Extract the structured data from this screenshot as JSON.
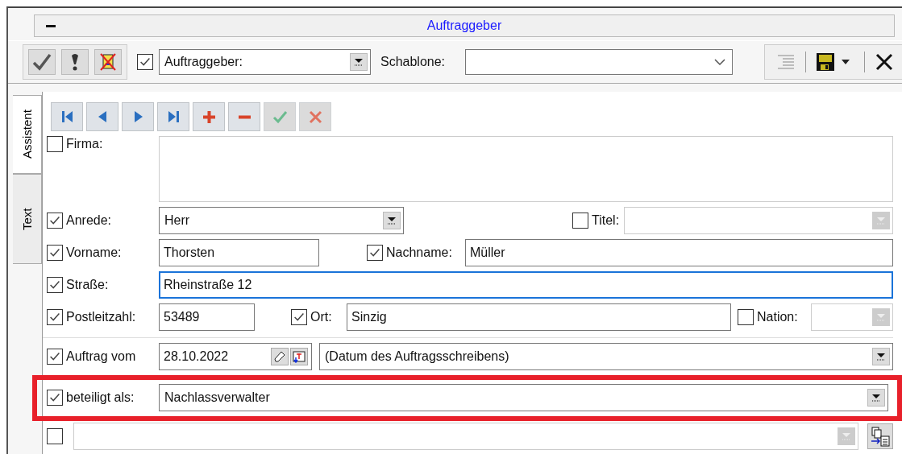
{
  "panel": {
    "title": "Auftraggeber"
  },
  "toolbar": {
    "actions": [
      {
        "kind": "accept"
      },
      {
        "kind": "hint"
      },
      {
        "kind": "discard"
      }
    ],
    "role": {
      "checked": true,
      "value": "Auftraggeber:"
    },
    "template_label": "Schablone:",
    "tools": [
      {
        "kind": "indent",
        "disabled": true
      },
      {
        "kind": "save"
      },
      {
        "kind": "close"
      }
    ]
  },
  "side_tabs": [
    {
      "label": "Assistent",
      "selected": true
    },
    {
      "label": "Text",
      "selected": false
    }
  ],
  "record_nav": [
    {
      "kind": "first",
      "disabled": false
    },
    {
      "kind": "prev",
      "disabled": false
    },
    {
      "kind": "next",
      "disabled": false
    },
    {
      "kind": "last",
      "disabled": false
    },
    {
      "kind": "add",
      "disabled": false
    },
    {
      "kind": "remove",
      "disabled": false
    },
    {
      "kind": "confirm",
      "disabled": true
    },
    {
      "kind": "cancel",
      "disabled": true
    }
  ],
  "form": {
    "firma": {
      "label": "Firma:",
      "checked": false
    },
    "anrede": {
      "label": "Anrede:",
      "checked": true,
      "value": "Herr"
    },
    "titel": {
      "label": "Titel:",
      "checked": false,
      "disabled": true
    },
    "vorname": {
      "label": "Vorname:",
      "checked": true,
      "value": "Thorsten"
    },
    "nachname": {
      "label": "Nachname:",
      "checked": true,
      "value": "Müller"
    },
    "strasse": {
      "label": "Straße:",
      "checked": true,
      "value": "Rheinstraße 12",
      "focused": true
    },
    "plz": {
      "label": "Postleitzahl:",
      "checked": true,
      "value": "53489"
    },
    "ort": {
      "label": "Ort:",
      "checked": true,
      "value": "Sinzig"
    },
    "nation": {
      "label": "Nation:",
      "checked": false,
      "disabled": true
    },
    "auftrag_vom": {
      "label": "Auftrag vom",
      "checked": true,
      "value": "28.10.2022"
    },
    "datum_hint": {
      "value": "(Datum des Auftragsschreibens)"
    },
    "beteiligt": {
      "label": "beteiligt als:",
      "checked": true,
      "value": "Nachlassverwalter",
      "highlighted": true
    },
    "extra": {
      "checked": false,
      "disabled": true
    }
  }
}
